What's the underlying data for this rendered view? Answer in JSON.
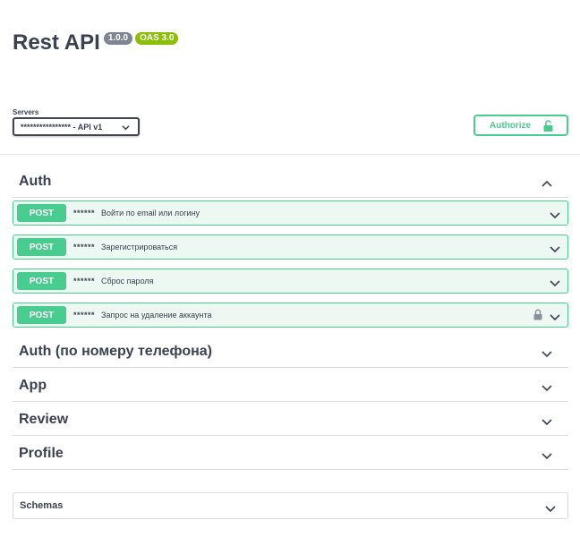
{
  "info": {
    "title": "Rest API",
    "version": "1.0.0",
    "oas": "OAS 3.0"
  },
  "servers": {
    "label": "Servers",
    "selected": "**************** - API v1"
  },
  "authorize": {
    "label": "Authorize"
  },
  "tags": [
    {
      "name": "Auth",
      "expanded": true,
      "operations": [
        {
          "method": "POST",
          "path": "******",
          "summary": "Войти по email или логину",
          "locked": false
        },
        {
          "method": "POST",
          "path": "******",
          "summary": "Зарегистрироваться",
          "locked": false
        },
        {
          "method": "POST",
          "path": "******",
          "summary": "Сброс пароля",
          "locked": false
        },
        {
          "method": "POST",
          "path": "******",
          "summary": "Запрос на удаление аккаунта",
          "locked": true
        }
      ]
    },
    {
      "name": "Auth (по номеру телефона)",
      "expanded": false
    },
    {
      "name": "App",
      "expanded": false
    },
    {
      "name": "Review",
      "expanded": false
    },
    {
      "name": "Profile",
      "expanded": false
    }
  ],
  "schemas": {
    "label": "Schemas"
  },
  "colors": {
    "post": "#49cc90",
    "post_bg": "#edf8f2",
    "text": "#3b4151",
    "version_badge": "#7d8492",
    "oas_badge": "#89bf04"
  }
}
